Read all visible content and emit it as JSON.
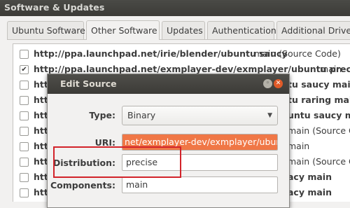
{
  "window": {
    "title": "Software & Updates"
  },
  "tabs": [
    {
      "label": "Ubuntu Software"
    },
    {
      "label": "Other Software"
    },
    {
      "label": "Updates"
    },
    {
      "label": "Authentication"
    },
    {
      "label": "Additional Drivers"
    }
  ],
  "sources": [
    {
      "checked": false,
      "url": "http://ppa.launchpad.net/irie/blender/ubuntu saucy",
      "rest": " main (Source Code)"
    },
    {
      "checked": true,
      "url": "http://ppa.launchpad.net/exmplayer-dev/exmplayer/ubuntu precise",
      "rest": " main"
    },
    {
      "checked": false,
      "url": "htt",
      "rest": "tu saucy main"
    },
    {
      "checked": false,
      "url": "htt",
      "rest": "tu raring main"
    },
    {
      "checked": false,
      "url": "htt",
      "rest": "untu saucy main"
    },
    {
      "checked": false,
      "url": "htt",
      "rest": "main (Source Code"
    },
    {
      "checked": false,
      "url": "htt",
      "rest": "main"
    },
    {
      "checked": false,
      "url": "htt",
      "rest": "main (Source Code"
    },
    {
      "checked": false,
      "url": "htt",
      "rest": "acy main"
    },
    {
      "checked": false,
      "url": "htt",
      "rest": "acy main"
    }
  ],
  "dialog": {
    "title": "Edit Source",
    "type_label": "Type:",
    "type_value": "Binary",
    "uri_label": "URI:",
    "uri_value": "net/exmplayer-dev/exmplayer/ubuntu",
    "distribution_label": "Distribution:",
    "distribution_value": "precise",
    "components_label": "Components:",
    "components_value": "main"
  },
  "colors": {
    "highlight": "#d2232a",
    "selection": "#f07746",
    "close": "#e05a28"
  },
  "icons": {
    "minimize": "minimize-icon",
    "close": "close-icon",
    "dropdown": "chevron-down-icon"
  }
}
